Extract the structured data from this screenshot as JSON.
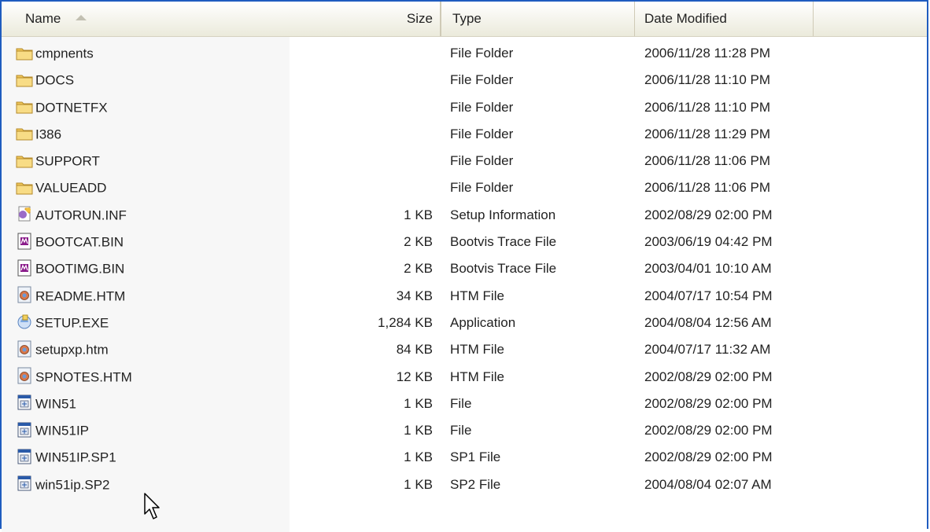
{
  "columns": {
    "name": "Name",
    "size": "Size",
    "type": "Type",
    "date": "Date Modified"
  },
  "colors": {
    "frame_border": "#1f5cbf",
    "folder_fill": "#f5d76e"
  },
  "files": [
    {
      "name": "cmpnents",
      "size": "",
      "type": "File Folder",
      "date": "2006/11/28 11:28 PM",
      "icon": "folder-icon"
    },
    {
      "name": "DOCS",
      "size": "",
      "type": "File Folder",
      "date": "2006/11/28 11:10 PM",
      "icon": "folder-icon"
    },
    {
      "name": "DOTNETFX",
      "size": "",
      "type": "File Folder",
      "date": "2006/11/28 11:10 PM",
      "icon": "folder-icon"
    },
    {
      "name": "I386",
      "size": "",
      "type": "File Folder",
      "date": "2006/11/28 11:29 PM",
      "icon": "folder-icon"
    },
    {
      "name": "SUPPORT",
      "size": "",
      "type": "File Folder",
      "date": "2006/11/28 11:06 PM",
      "icon": "folder-icon"
    },
    {
      "name": "VALUEADD",
      "size": "",
      "type": "File Folder",
      "date": "2006/11/28 11:06 PM",
      "icon": "folder-icon"
    },
    {
      "name": "AUTORUN.INF",
      "size": "1 KB",
      "type": "Setup Information",
      "date": "2002/08/29 02:00 PM",
      "icon": "setup-info-icon"
    },
    {
      "name": "BOOTCAT.BIN",
      "size": "2 KB",
      "type": "Bootvis Trace File",
      "date": "2003/06/19 04:42 PM",
      "icon": "trace-file-icon"
    },
    {
      "name": "BOOTIMG.BIN",
      "size": "2 KB",
      "type": "Bootvis Trace File",
      "date": "2003/04/01 10:10 AM",
      "icon": "trace-file-icon"
    },
    {
      "name": "README.HTM",
      "size": "34 KB",
      "type": "HTM File",
      "date": "2004/07/17 10:54 PM",
      "icon": "htm-file-icon"
    },
    {
      "name": "SETUP.EXE",
      "size": "1,284 KB",
      "type": "Application",
      "date": "2004/08/04 12:56 AM",
      "icon": "setup-exe-icon"
    },
    {
      "name": "setupxp.htm",
      "size": "84 KB",
      "type": "HTM File",
      "date": "2004/07/17 11:32 AM",
      "icon": "htm-file-icon"
    },
    {
      "name": "SPNOTES.HTM",
      "size": "12 KB",
      "type": "HTM File",
      "date": "2002/08/29 02:00 PM",
      "icon": "htm-file-icon"
    },
    {
      "name": "WIN51",
      "size": "1 KB",
      "type": "File",
      "date": "2002/08/29 02:00 PM",
      "icon": "generic-file-icon"
    },
    {
      "name": "WIN51IP",
      "size": "1 KB",
      "type": "File",
      "date": "2002/08/29 02:00 PM",
      "icon": "generic-file-icon"
    },
    {
      "name": "WIN51IP.SP1",
      "size": "1 KB",
      "type": "SP1 File",
      "date": "2002/08/29 02:00 PM",
      "icon": "generic-file-icon"
    },
    {
      "name": "win51ip.SP2",
      "size": "1 KB",
      "type": "SP2 File",
      "date": "2004/08/04 02:07 AM",
      "icon": "generic-file-icon"
    }
  ]
}
